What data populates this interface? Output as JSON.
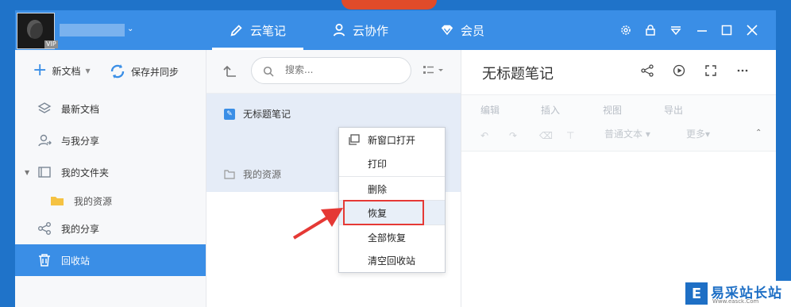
{
  "colors": {
    "accent": "#3a8ee6",
    "highlight_box": "#e53935",
    "arrow": "#e53935"
  },
  "user": {
    "badge": "VIP"
  },
  "nav": {
    "tabs": [
      {
        "label": "云笔记",
        "icon": "pencil-icon"
      },
      {
        "label": "云协作",
        "icon": "person-icon"
      },
      {
        "label": "会员",
        "icon": "diamond-icon"
      }
    ]
  },
  "window_controls": [
    "gear-icon",
    "lock-icon",
    "download-icon",
    "minimize-icon",
    "maximize-icon",
    "close-icon"
  ],
  "sidebar": {
    "new_doc": "新文档",
    "sync": "保存并同步",
    "items": [
      {
        "label": "最新文档",
        "icon": "layers-icon"
      },
      {
        "label": "与我分享",
        "icon": "user-share-icon"
      },
      {
        "label": "我的文件夹",
        "icon": "folder-icon"
      },
      {
        "label": "我的资源",
        "icon": "yellow-folder-icon"
      },
      {
        "label": "我的分享",
        "icon": "share-icon"
      },
      {
        "label": "回收站",
        "icon": "trash-icon"
      }
    ]
  },
  "list": {
    "search_placeholder": "搜索...",
    "rows": [
      {
        "label": "无标题笔记"
      },
      {
        "label": "我的资源"
      }
    ]
  },
  "editor": {
    "title": "无标题笔记",
    "menu": [
      "编辑",
      "插入",
      "视图",
      "导出"
    ],
    "style_select": "普通文本",
    "more_select": "更多"
  },
  "context_menu": {
    "items": [
      "新窗口打开",
      "打印",
      "删除",
      "恢复",
      "全部恢复",
      "清空回收站"
    ]
  },
  "watermark": {
    "text": "易采站长站",
    "url": "Www.easck.Com"
  }
}
